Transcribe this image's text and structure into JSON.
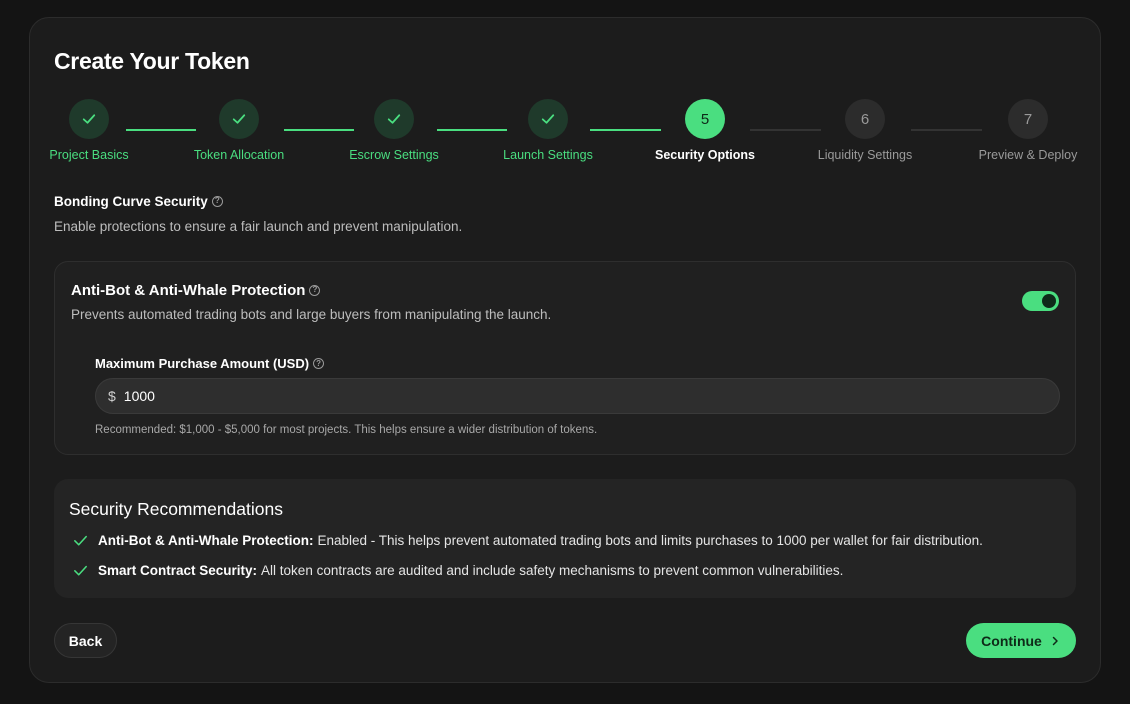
{
  "page": {
    "title": "Create Your Token"
  },
  "stepper": {
    "steps": [
      {
        "number": "1",
        "label": "Project Basics",
        "status": "done"
      },
      {
        "number": "2",
        "label": "Token Allocation",
        "status": "done"
      },
      {
        "number": "3",
        "label": "Escrow Settings",
        "status": "done"
      },
      {
        "number": "4",
        "label": "Launch Settings",
        "status": "done"
      },
      {
        "number": "5",
        "label": "Security Options",
        "status": "active"
      },
      {
        "number": "6",
        "label": "Liquidity Settings",
        "status": "pending"
      },
      {
        "number": "7",
        "label": "Preview & Deploy",
        "status": "pending"
      }
    ]
  },
  "section": {
    "title": "Bonding Curve Security",
    "subtitle": "Enable protections to ensure a fair launch and prevent manipulation."
  },
  "protection": {
    "title": "Anti-Bot & Anti-Whale Protection",
    "description": "Prevents automated trading bots and large buyers from manipulating the launch.",
    "enabled": true,
    "field_label": "Maximum Purchase Amount (USD)",
    "currency_prefix": "$",
    "value": "1000",
    "hint": "Recommended: $1,000 - $5,000 for most projects. This helps ensure a wider distribution of tokens."
  },
  "recommendations": {
    "title": "Security Recommendations",
    "items": [
      {
        "bold": "Anti-Bot & Anti-Whale Protection:",
        "text": "Enabled - This helps prevent automated trading bots and limits purchases to 1000 per wallet for fair distribution."
      },
      {
        "bold": "Smart Contract Security:",
        "text": "All token contracts are audited and include safety mechanisms to prevent common vulnerabilities."
      }
    ]
  },
  "actions": {
    "back_label": "Back",
    "continue_label": "Continue"
  },
  "colors": {
    "accent": "#4ade80",
    "background": "#141414",
    "card": "#1c1c1c"
  },
  "icons": {
    "done_step": "check-icon",
    "help": "help-icon",
    "continue": "chevron-right-icon",
    "recommendation": "check-icon"
  }
}
